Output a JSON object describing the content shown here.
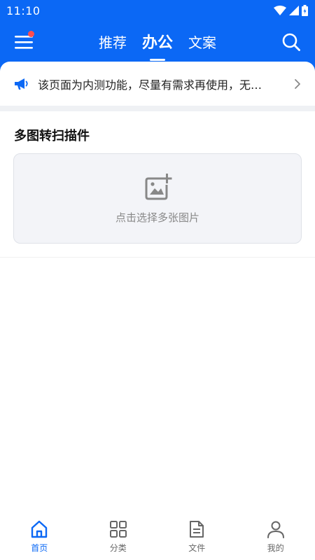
{
  "status_bar": {
    "time": "11:10"
  },
  "header": {
    "tabs": [
      {
        "label": "推荐",
        "active": false
      },
      {
        "label": "办公",
        "active": true
      },
      {
        "label": "文案",
        "active": false
      }
    ],
    "menu_badge": true
  },
  "notice": {
    "text": "该页面为内测功能，尽量有需求再使用，无…"
  },
  "section": {
    "title": "多图转扫描件",
    "upload_hint": "点击选择多张图片"
  },
  "bottom_nav": [
    {
      "label": "首页",
      "icon": "home-icon",
      "active": true
    },
    {
      "label": "分类",
      "icon": "grid-icon",
      "active": false
    },
    {
      "label": "文件",
      "icon": "file-icon",
      "active": false
    },
    {
      "label": "我的",
      "icon": "user-icon",
      "active": false
    }
  ],
  "colors": {
    "primary": "#0b68f5",
    "badge": "#ff4d4f",
    "upload_bg": "#f3f4f8"
  }
}
